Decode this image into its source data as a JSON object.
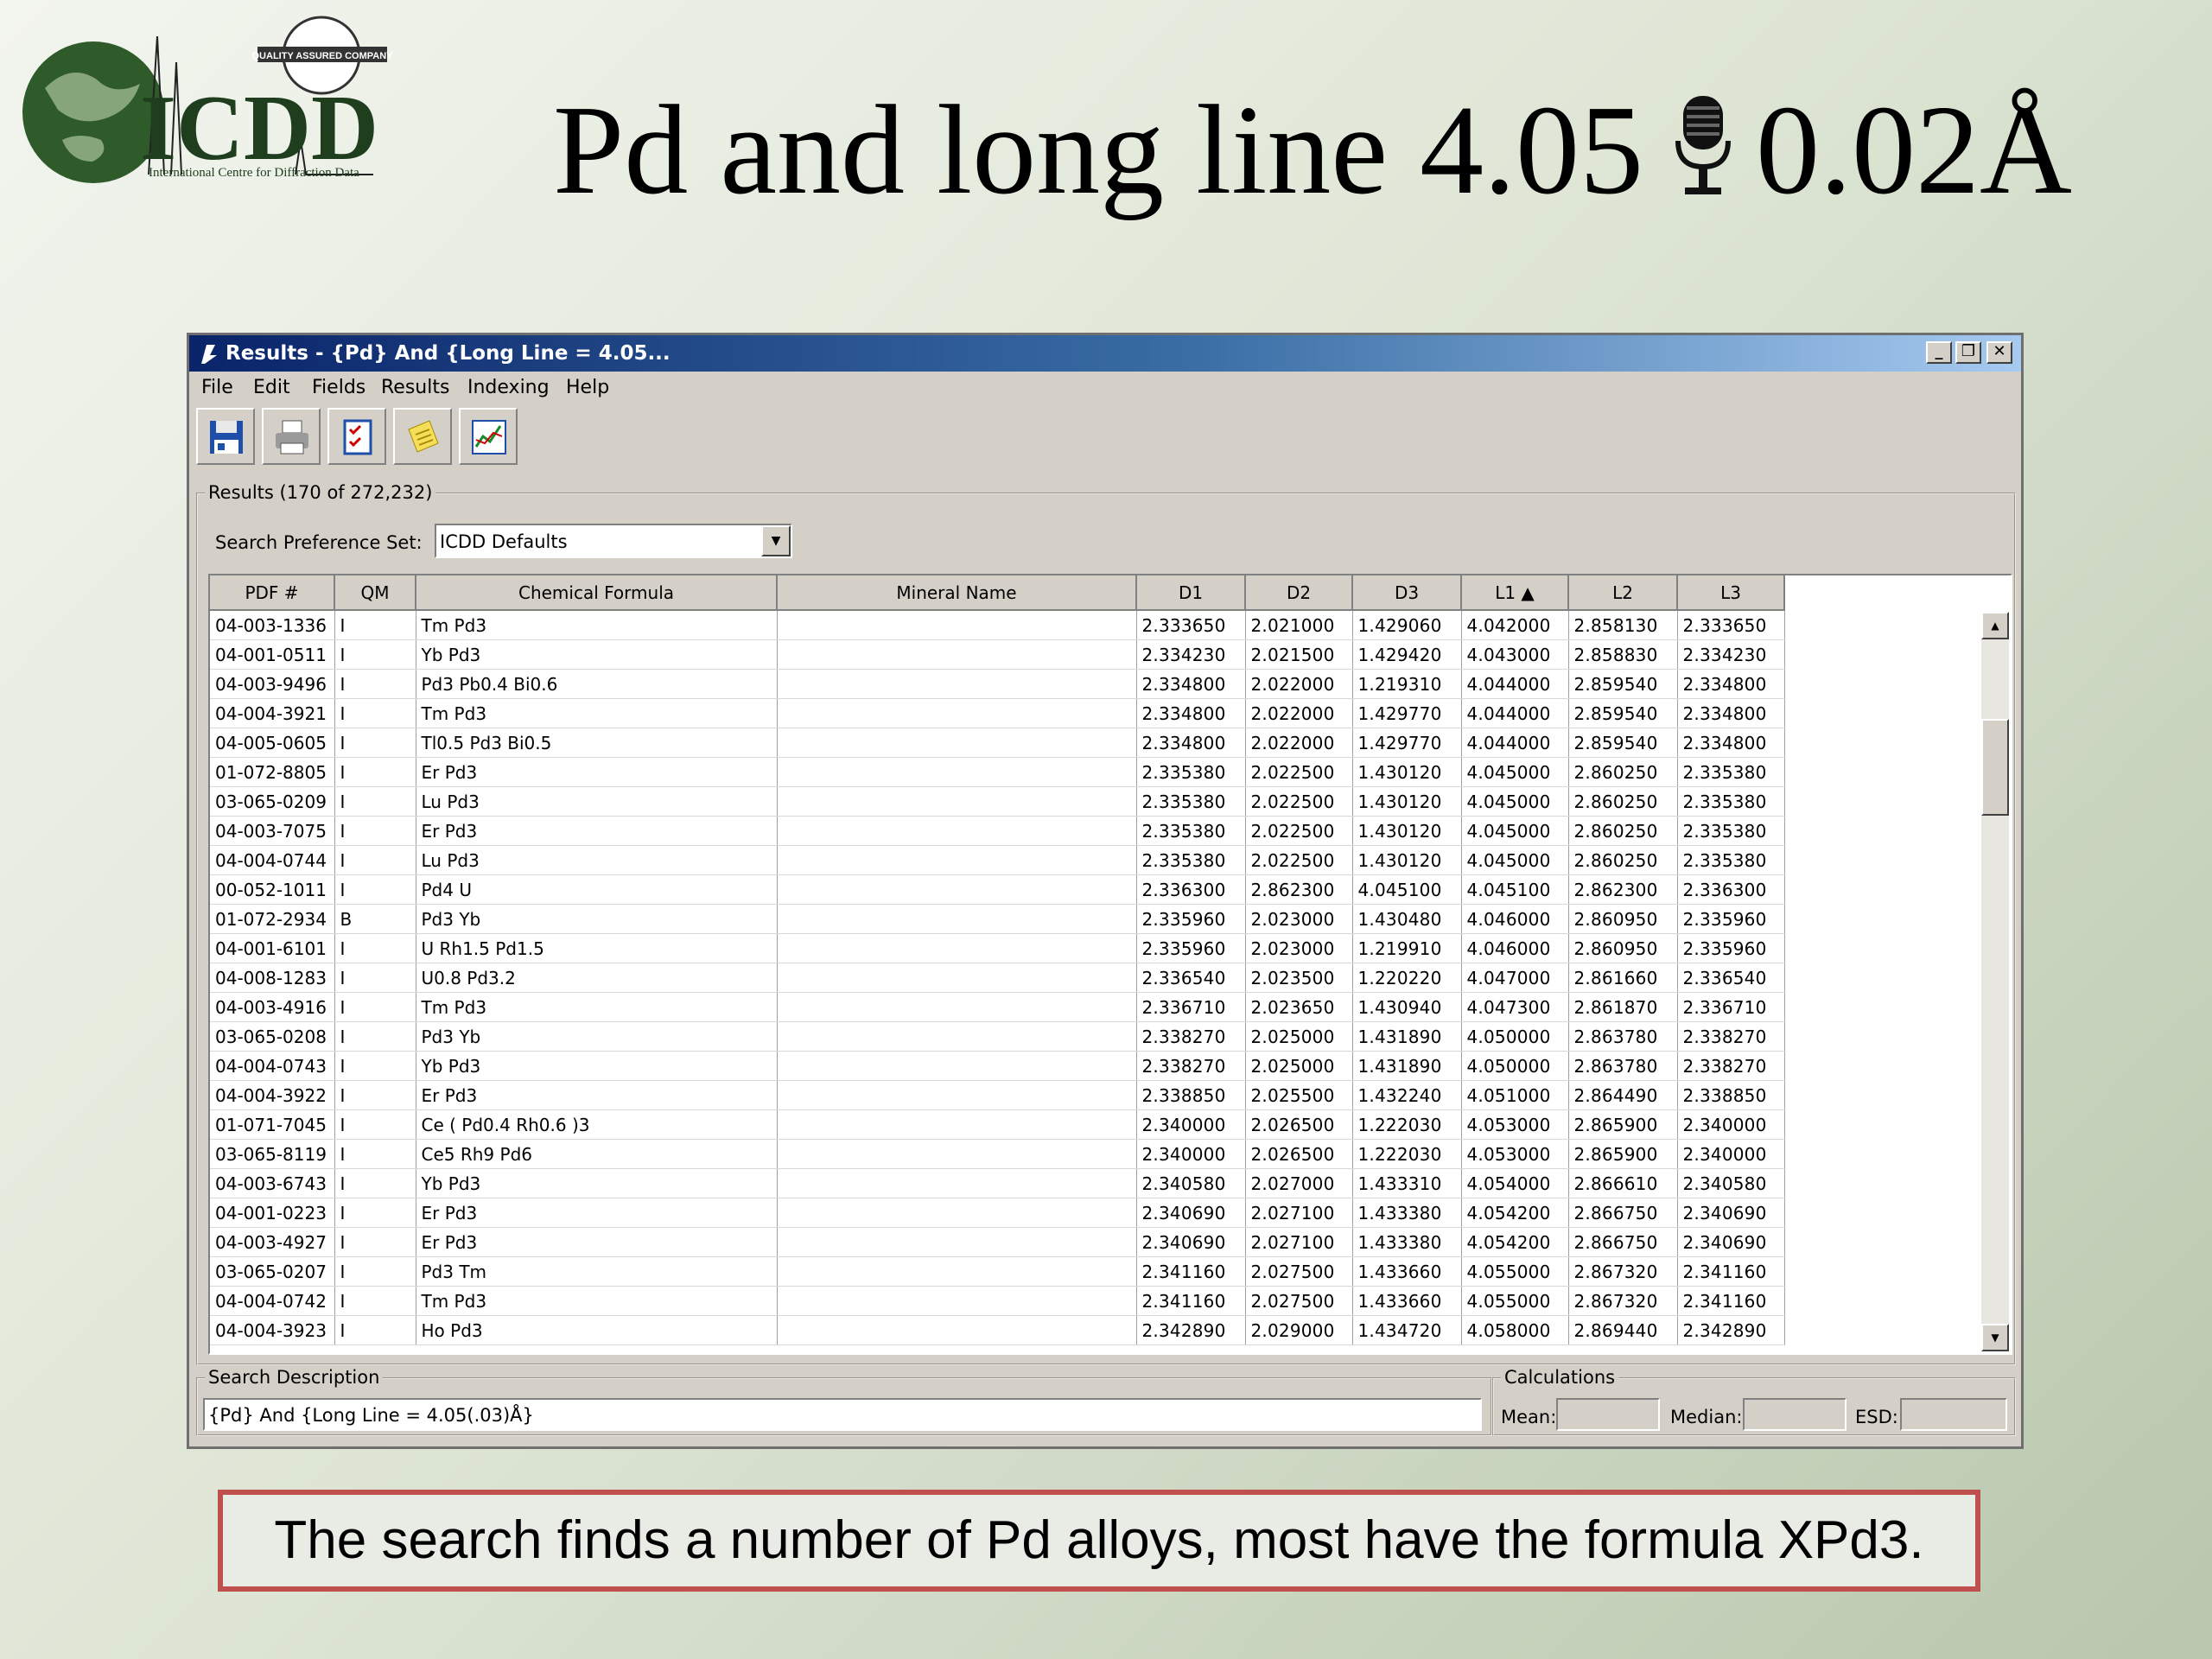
{
  "slide": {
    "title_before": "Pd and long line 4.05",
    "title_after": "0.02Å",
    "logo_text": "ICDD",
    "logo_subtext": "International Centre for Diffraction Data",
    "logo_badge": "QUALITY ASSURED COMPANY",
    "caption": "The search finds a number of Pd alloys, most have the formula XPd3."
  },
  "window": {
    "title": "Results - {Pd} And {Long Line = 4.05...",
    "menu": [
      "File",
      "Edit",
      "Fields",
      "Results",
      "Indexing",
      "Help"
    ],
    "toolbar_icons": [
      "save-icon",
      "print-icon",
      "checklist-icon",
      "notes-icon",
      "graph-icon"
    ]
  },
  "results": {
    "label": "Results (170 of 272,232)",
    "pref_label": "Search Preference Set:",
    "pref_value": "ICDD Defaults"
  },
  "table": {
    "columns": [
      "PDF #",
      "QM",
      "Chemical Formula",
      "Mineral Name",
      "D1",
      "D2",
      "D3",
      "L1 ▲",
      "L2",
      "L3"
    ],
    "rows": [
      [
        "04-003-1336",
        "I",
        "Tm Pd3",
        "",
        "2.333650",
        "2.021000",
        "1.429060",
        "4.042000",
        "2.858130",
        "2.333650"
      ],
      [
        "04-001-0511",
        "I",
        "Yb Pd3",
        "",
        "2.334230",
        "2.021500",
        "1.429420",
        "4.043000",
        "2.858830",
        "2.334230"
      ],
      [
        "04-003-9496",
        "I",
        "Pd3 Pb0.4 Bi0.6",
        "",
        "2.334800",
        "2.022000",
        "1.219310",
        "4.044000",
        "2.859540",
        "2.334800"
      ],
      [
        "04-004-3921",
        "I",
        "Tm Pd3",
        "",
        "2.334800",
        "2.022000",
        "1.429770",
        "4.044000",
        "2.859540",
        "2.334800"
      ],
      [
        "04-005-0605",
        "I",
        "Tl0.5 Pd3 Bi0.5",
        "",
        "2.334800",
        "2.022000",
        "1.429770",
        "4.044000",
        "2.859540",
        "2.334800"
      ],
      [
        "01-072-8805",
        "I",
        "Er Pd3",
        "",
        "2.335380",
        "2.022500",
        "1.430120",
        "4.045000",
        "2.860250",
        "2.335380"
      ],
      [
        "03-065-0209",
        "I",
        "Lu Pd3",
        "",
        "2.335380",
        "2.022500",
        "1.430120",
        "4.045000",
        "2.860250",
        "2.335380"
      ],
      [
        "04-003-7075",
        "I",
        "Er Pd3",
        "",
        "2.335380",
        "2.022500",
        "1.430120",
        "4.045000",
        "2.860250",
        "2.335380"
      ],
      [
        "04-004-0744",
        "I",
        "Lu Pd3",
        "",
        "2.335380",
        "2.022500",
        "1.430120",
        "4.045000",
        "2.860250",
        "2.335380"
      ],
      [
        "00-052-1011",
        "I",
        "Pd4 U",
        "",
        "2.336300",
        "2.862300",
        "4.045100",
        "4.045100",
        "2.862300",
        "2.336300"
      ],
      [
        "01-072-2934",
        "B",
        "Pd3 Yb",
        "",
        "2.335960",
        "2.023000",
        "1.430480",
        "4.046000",
        "2.860950",
        "2.335960"
      ],
      [
        "04-001-6101",
        "I",
        "U Rh1.5 Pd1.5",
        "",
        "2.335960",
        "2.023000",
        "1.219910",
        "4.046000",
        "2.860950",
        "2.335960"
      ],
      [
        "04-008-1283",
        "I",
        "U0.8 Pd3.2",
        "",
        "2.336540",
        "2.023500",
        "1.220220",
        "4.047000",
        "2.861660",
        "2.336540"
      ],
      [
        "04-003-4916",
        "I",
        "Tm Pd3",
        "",
        "2.336710",
        "2.023650",
        "1.430940",
        "4.047300",
        "2.861870",
        "2.336710"
      ],
      [
        "03-065-0208",
        "I",
        "Pd3 Yb",
        "",
        "2.338270",
        "2.025000",
        "1.431890",
        "4.050000",
        "2.863780",
        "2.338270"
      ],
      [
        "04-004-0743",
        "I",
        "Yb Pd3",
        "",
        "2.338270",
        "2.025000",
        "1.431890",
        "4.050000",
        "2.863780",
        "2.338270"
      ],
      [
        "04-004-3922",
        "I",
        "Er Pd3",
        "",
        "2.338850",
        "2.025500",
        "1.432240",
        "4.051000",
        "2.864490",
        "2.338850"
      ],
      [
        "01-071-7045",
        "I",
        "Ce ( Pd0.4 Rh0.6 )3",
        "",
        "2.340000",
        "2.026500",
        "1.222030",
        "4.053000",
        "2.865900",
        "2.340000"
      ],
      [
        "03-065-8119",
        "I",
        "Ce5 Rh9 Pd6",
        "",
        "2.340000",
        "2.026500",
        "1.222030",
        "4.053000",
        "2.865900",
        "2.340000"
      ],
      [
        "04-003-6743",
        "I",
        "Yb Pd3",
        "",
        "2.340580",
        "2.027000",
        "1.433310",
        "4.054000",
        "2.866610",
        "2.340580"
      ],
      [
        "04-001-0223",
        "I",
        "Er Pd3",
        "",
        "2.340690",
        "2.027100",
        "1.433380",
        "4.054200",
        "2.866750",
        "2.340690"
      ],
      [
        "04-003-4927",
        "I",
        "Er Pd3",
        "",
        "2.340690",
        "2.027100",
        "1.433380",
        "4.054200",
        "2.866750",
        "2.340690"
      ],
      [
        "03-065-0207",
        "I",
        "Pd3 Tm",
        "",
        "2.341160",
        "2.027500",
        "1.433660",
        "4.055000",
        "2.867320",
        "2.341160"
      ],
      [
        "04-004-0742",
        "I",
        "Tm Pd3",
        "",
        "2.341160",
        "2.027500",
        "1.433660",
        "4.055000",
        "2.867320",
        "2.341160"
      ],
      [
        "04-004-3923",
        "I",
        "Ho Pd3",
        "",
        "2.342890",
        "2.029000",
        "1.434720",
        "4.058000",
        "2.869440",
        "2.342890"
      ]
    ]
  },
  "search_description": {
    "label": "Search Description",
    "value": "{Pd} And {Long Line = 4.05(.03)Å}"
  },
  "calculations": {
    "label": "Calculations",
    "mean_label": "Mean:",
    "median_label": "Median:",
    "esd_label": "ESD:",
    "mean_value": "",
    "median_value": "",
    "esd_value": ""
  }
}
